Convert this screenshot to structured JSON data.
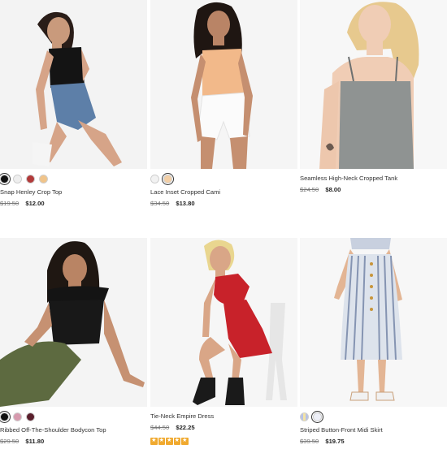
{
  "products": [
    {
      "name": "Snap Henley Crop Top",
      "price_original": "$19.50",
      "price_sale": "$12.00",
      "swatches": [
        "#111111",
        "#eeeeee",
        "#b23a3a",
        "#f0c48a"
      ],
      "selected_swatch": 0,
      "rating_stars": 0,
      "image": "woman-black-crop-top-denim-shorts"
    },
    {
      "name": "Lace Inset Cropped Cami",
      "price_original": "$34.50",
      "price_sale": "$13.80",
      "swatches": [
        "#f2f2f2",
        "#f3cfa6"
      ],
      "selected_swatch": 1,
      "rating_stars": 0,
      "image": "woman-peach-cami-white-shorts"
    },
    {
      "name": "Seamless High-Neck Cropped Tank",
      "price_original": "$24.50",
      "price_sale": "$8.00",
      "swatches": [],
      "selected_swatch": -1,
      "rating_stars": 0,
      "image": "woman-grey-tank"
    },
    {
      "name": "Ribbed Off-The-Shoulder Bodycon Top",
      "price_original": "$29.50",
      "price_sale": "$11.80",
      "swatches": [
        "#111111",
        "#d79aae",
        "#5a1f2c"
      ],
      "selected_swatch": 0,
      "rating_stars": 0,
      "image": "woman-black-offshoulder-top-olive-pants"
    },
    {
      "name": "Tie-Neck Empire Dress",
      "price_original": "$44.50",
      "price_sale": "$22.25",
      "swatches": [],
      "selected_swatch": -1,
      "rating_stars": 5,
      "image": "woman-red-dress-chair"
    },
    {
      "name": "Striped Button-Front Midi Skirt",
      "price_original": "$39.50",
      "price_sale": "$19.75",
      "swatches": [
        "#c9cfe6",
        "#eef0f8"
      ],
      "selected_swatch": 1,
      "rating_stars": 0,
      "image": "woman-striped-midi-skirt"
    }
  ],
  "colors": {
    "star": "#f0a92e",
    "sale_text": "#222222",
    "old_text": "#777777"
  }
}
